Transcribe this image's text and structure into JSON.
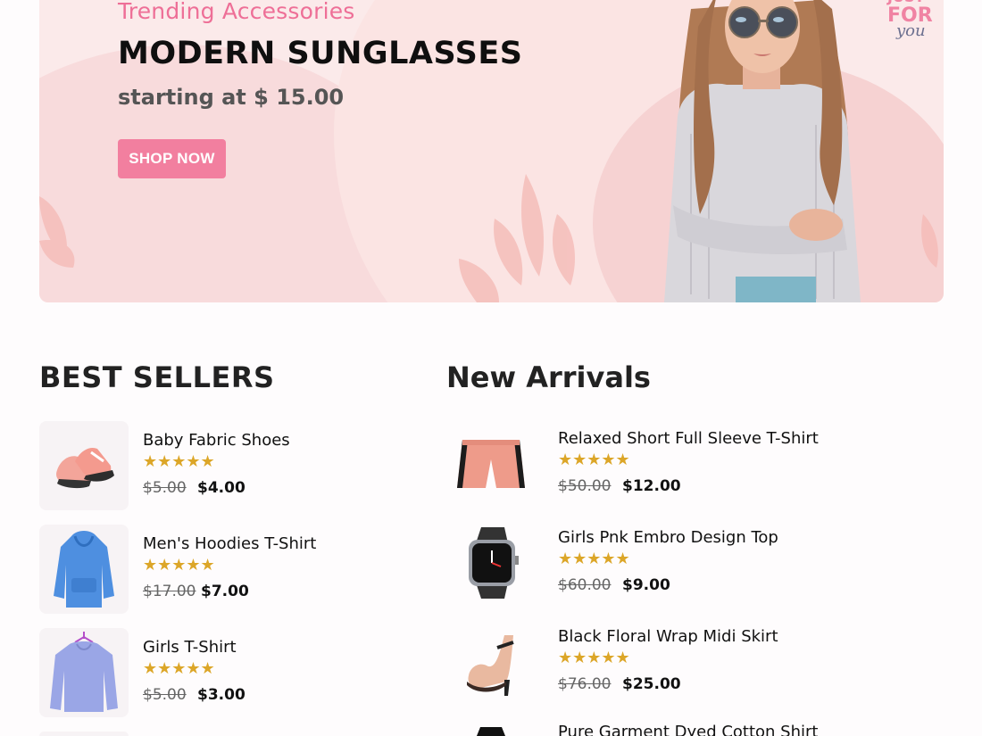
{
  "hero": {
    "eyebrow": "Trending Accessories",
    "title": "MODERN SUNGLASSES",
    "subtitle": "starting at $ 15.00",
    "button": "SHOP NOW",
    "logo_text": "JUST FOR you"
  },
  "best_sellers": {
    "title": "BEST SELLERS",
    "items": [
      {
        "name": "Baby Fabric Shoes",
        "rating": "★★★★★",
        "old_price": "$5.00",
        "price": "$4.00",
        "icon": "baby-shoes-icon"
      },
      {
        "name": "Men's Hoodies T-Shirt",
        "rating": "★★★★★",
        "old_price": "$17.00",
        "price": "$7.00",
        "icon": "hoodie-icon"
      },
      {
        "name": "Girls T-Shirt",
        "rating": "★★★★★",
        "old_price": "$5.00",
        "price": "$3.00",
        "icon": "sweater-icon"
      }
    ]
  },
  "new_arrivals": {
    "title": "New Arrivals",
    "items": [
      {
        "name": "Relaxed Short Full Sleeve T-Shirt",
        "rating": "★★★★★",
        "old_price": "$50.00",
        "price": "$12.00",
        "icon": "shorts-icon"
      },
      {
        "name": "Girls Pnk Embro Design Top",
        "rating": "★★★★★",
        "old_price": "$60.00",
        "price": "$9.00",
        "icon": "smartwatch-icon"
      },
      {
        "name": "Black Floral Wrap Midi Skirt",
        "rating": "★★★★★",
        "old_price": "$76.00",
        "price": "$25.00",
        "icon": "heel-shoe-icon"
      },
      {
        "name": "Pure Garment Dyed Cotton Shirt",
        "icon": "shirt-icon"
      }
    ]
  },
  "colors": {
    "accent": "#f27f9f",
    "star": "#dca628",
    "hero_bg": "#fbeaea"
  }
}
